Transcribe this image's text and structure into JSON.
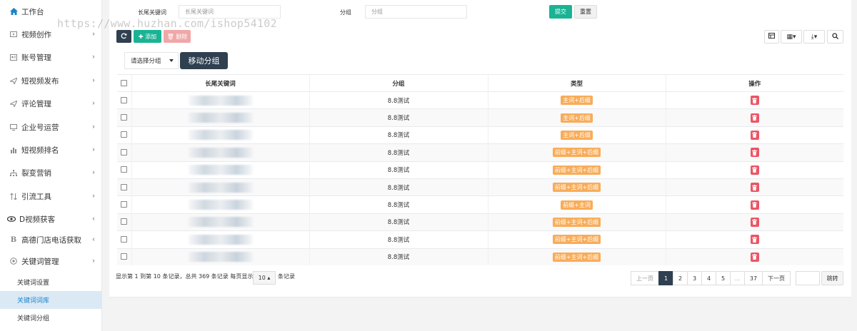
{
  "sidebar": {
    "top_item": {
      "label": "工作台",
      "icon": "home-icon"
    },
    "items": [
      {
        "label": "视频创作",
        "icon": "video-icon",
        "chev": "›"
      },
      {
        "label": "账号管理",
        "icon": "account-icon",
        "chev": "›"
      },
      {
        "label": "短视频发布",
        "icon": "send-icon",
        "chev": "›"
      },
      {
        "label": "评论管理",
        "icon": "comment-icon",
        "chev": "›"
      },
      {
        "label": "企业号运营",
        "icon": "enterprise-icon",
        "chev": "›"
      },
      {
        "label": "短视频排名",
        "icon": "bar-chart-icon",
        "chev": "›"
      },
      {
        "label": "裂变营销",
        "icon": "sitemap-icon",
        "chev": "›"
      },
      {
        "label": "引流工具",
        "icon": "sort-icon",
        "chev": "›"
      },
      {
        "label": "D视频获客",
        "icon": "eye-icon",
        "chev": "‹"
      },
      {
        "label": "高德门店电话获取",
        "icon": "bold-b-icon",
        "chev": "‹"
      },
      {
        "label": "关键词管理",
        "icon": "target-icon",
        "chev": "›"
      }
    ],
    "subitems": [
      {
        "label": "关键词设置"
      },
      {
        "label": "关键词词库"
      },
      {
        "label": "关键词分组"
      }
    ]
  },
  "search": {
    "keyword_label": "长尾关键词",
    "keyword_placeholder": "长尾关键词",
    "group_label": "分组",
    "group_placeholder": "分组",
    "submit_label": "提交",
    "reset_label": "重置"
  },
  "toolbar": {
    "add_label": "✚ 添加",
    "delete_label": "🗑 删除",
    "select_group": "请选择分组",
    "move_group_label": "移动分组"
  },
  "watermark": "https://www.huzhan.com/ishop54102",
  "table": {
    "headers": {
      "keyword": "长尾关键词",
      "group": "分组",
      "type": "类型",
      "action": "操作"
    },
    "rows": [
      {
        "group": "8.8测试",
        "type": "主词+后缀"
      },
      {
        "group": "8.8测试",
        "type": "主词+后缀"
      },
      {
        "group": "8.8测试",
        "type": "主词+后缀"
      },
      {
        "group": "8.8测试",
        "type": "前缀+主词+后缀"
      },
      {
        "group": "8.8测试",
        "type": "前缀+主词+后缀"
      },
      {
        "group": "8.8测试",
        "type": "前缀+主词+后缀"
      },
      {
        "group": "8.8测试",
        "type": "前缀+主词"
      },
      {
        "group": "8.8测试",
        "type": "前缀+主词+后缀"
      },
      {
        "group": "8.8测试",
        "type": "前缀+主词+后缀"
      },
      {
        "group": "8.8测试",
        "type": "前缀+主词+后缀"
      }
    ]
  },
  "footer": {
    "summary": "显示第 1 到第 10 条记录，总共 369 条记录 每页显示",
    "page_size": "10 ▴",
    "suffix": "条记录"
  },
  "pagination": {
    "prev": "上一页",
    "pages": [
      "1",
      "2",
      "3",
      "4",
      "5",
      "...",
      "37"
    ],
    "next": "下一页",
    "jump": "跳转",
    "current": "1"
  },
  "colors": {
    "primary": "#1ab394",
    "dark": "#2f4050",
    "warning": "#f8ac59",
    "danger": "#ed5565",
    "link": "#1c84c6"
  }
}
